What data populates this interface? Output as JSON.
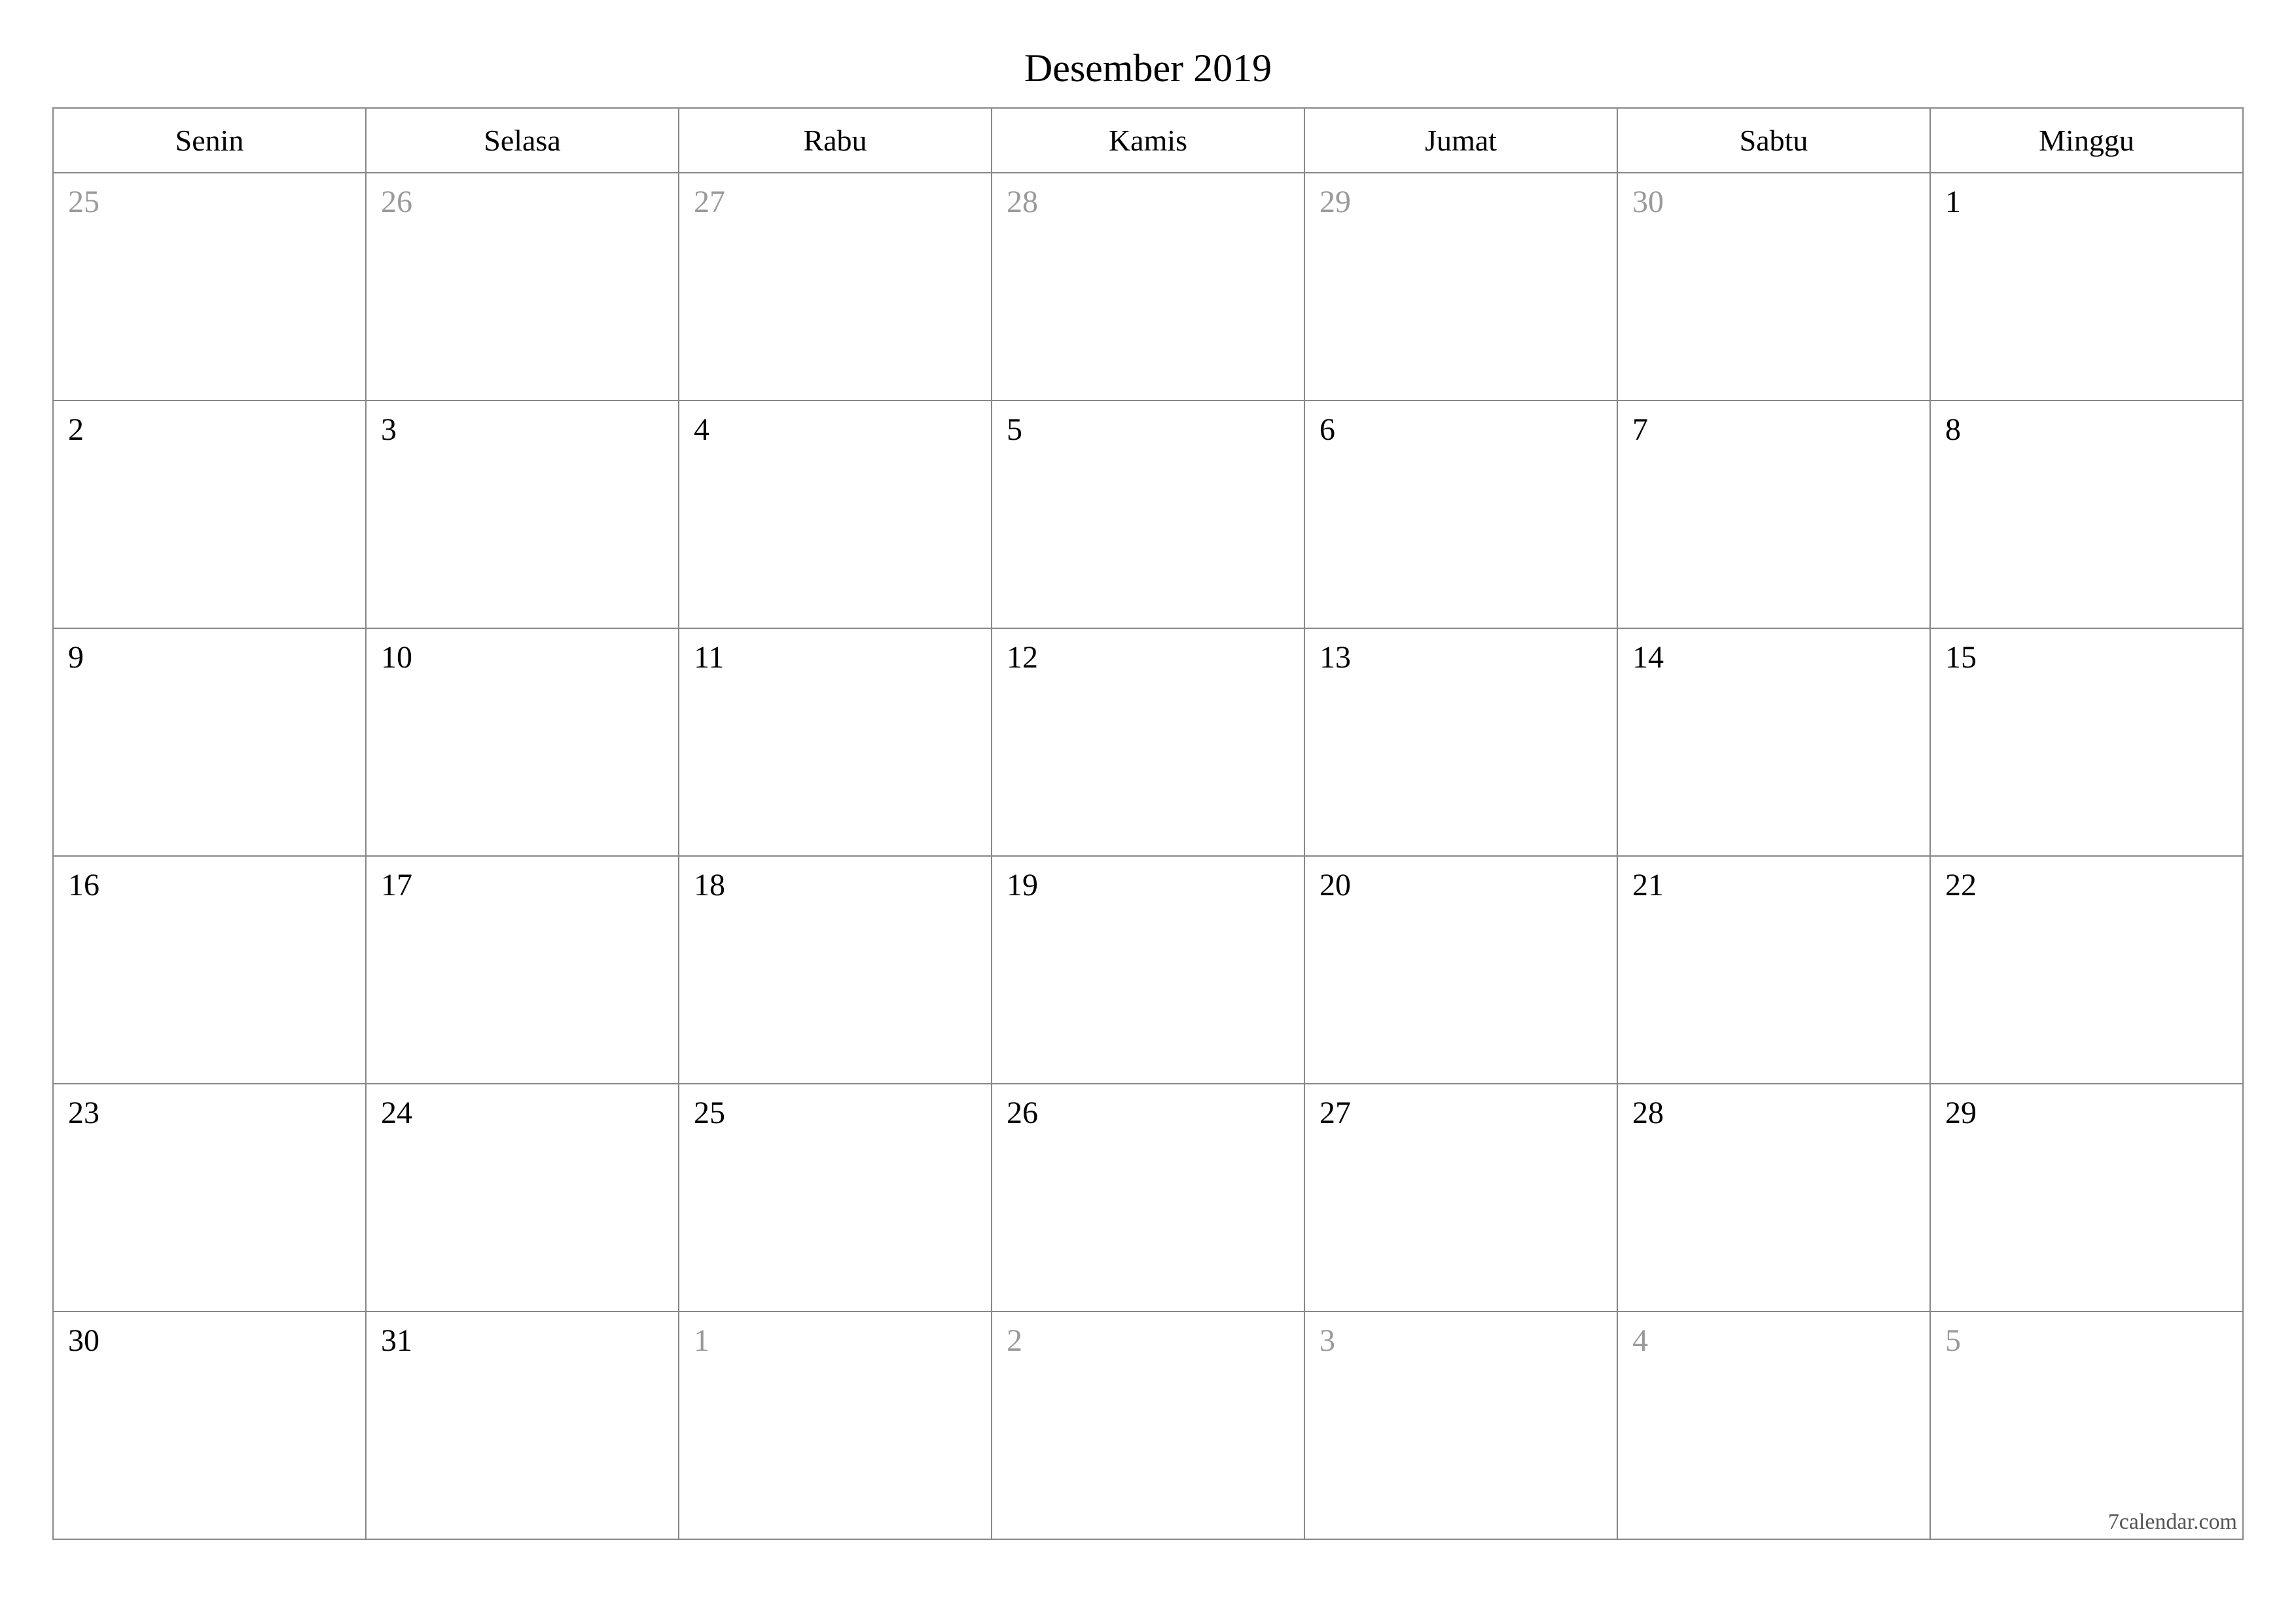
{
  "title": "Desember 2019",
  "weekdays": [
    "Senin",
    "Selasa",
    "Rabu",
    "Kamis",
    "Jumat",
    "Sabtu",
    "Minggu"
  ],
  "weeks": [
    [
      {
        "day": "25",
        "muted": true
      },
      {
        "day": "26",
        "muted": true
      },
      {
        "day": "27",
        "muted": true
      },
      {
        "day": "28",
        "muted": true
      },
      {
        "day": "29",
        "muted": true
      },
      {
        "day": "30",
        "muted": true
      },
      {
        "day": "1",
        "muted": false
      }
    ],
    [
      {
        "day": "2",
        "muted": false
      },
      {
        "day": "3",
        "muted": false
      },
      {
        "day": "4",
        "muted": false
      },
      {
        "day": "5",
        "muted": false
      },
      {
        "day": "6",
        "muted": false
      },
      {
        "day": "7",
        "muted": false
      },
      {
        "day": "8",
        "muted": false
      }
    ],
    [
      {
        "day": "9",
        "muted": false
      },
      {
        "day": "10",
        "muted": false
      },
      {
        "day": "11",
        "muted": false
      },
      {
        "day": "12",
        "muted": false
      },
      {
        "day": "13",
        "muted": false
      },
      {
        "day": "14",
        "muted": false
      },
      {
        "day": "15",
        "muted": false
      }
    ],
    [
      {
        "day": "16",
        "muted": false
      },
      {
        "day": "17",
        "muted": false
      },
      {
        "day": "18",
        "muted": false
      },
      {
        "day": "19",
        "muted": false
      },
      {
        "day": "20",
        "muted": false
      },
      {
        "day": "21",
        "muted": false
      },
      {
        "day": "22",
        "muted": false
      }
    ],
    [
      {
        "day": "23",
        "muted": false
      },
      {
        "day": "24",
        "muted": false
      },
      {
        "day": "25",
        "muted": false
      },
      {
        "day": "26",
        "muted": false
      },
      {
        "day": "27",
        "muted": false
      },
      {
        "day": "28",
        "muted": false
      },
      {
        "day": "29",
        "muted": false
      }
    ],
    [
      {
        "day": "30",
        "muted": false
      },
      {
        "day": "31",
        "muted": false
      },
      {
        "day": "1",
        "muted": true
      },
      {
        "day": "2",
        "muted": true
      },
      {
        "day": "3",
        "muted": true
      },
      {
        "day": "4",
        "muted": true
      },
      {
        "day": "5",
        "muted": true
      }
    ]
  ],
  "footer": "7calendar.com"
}
